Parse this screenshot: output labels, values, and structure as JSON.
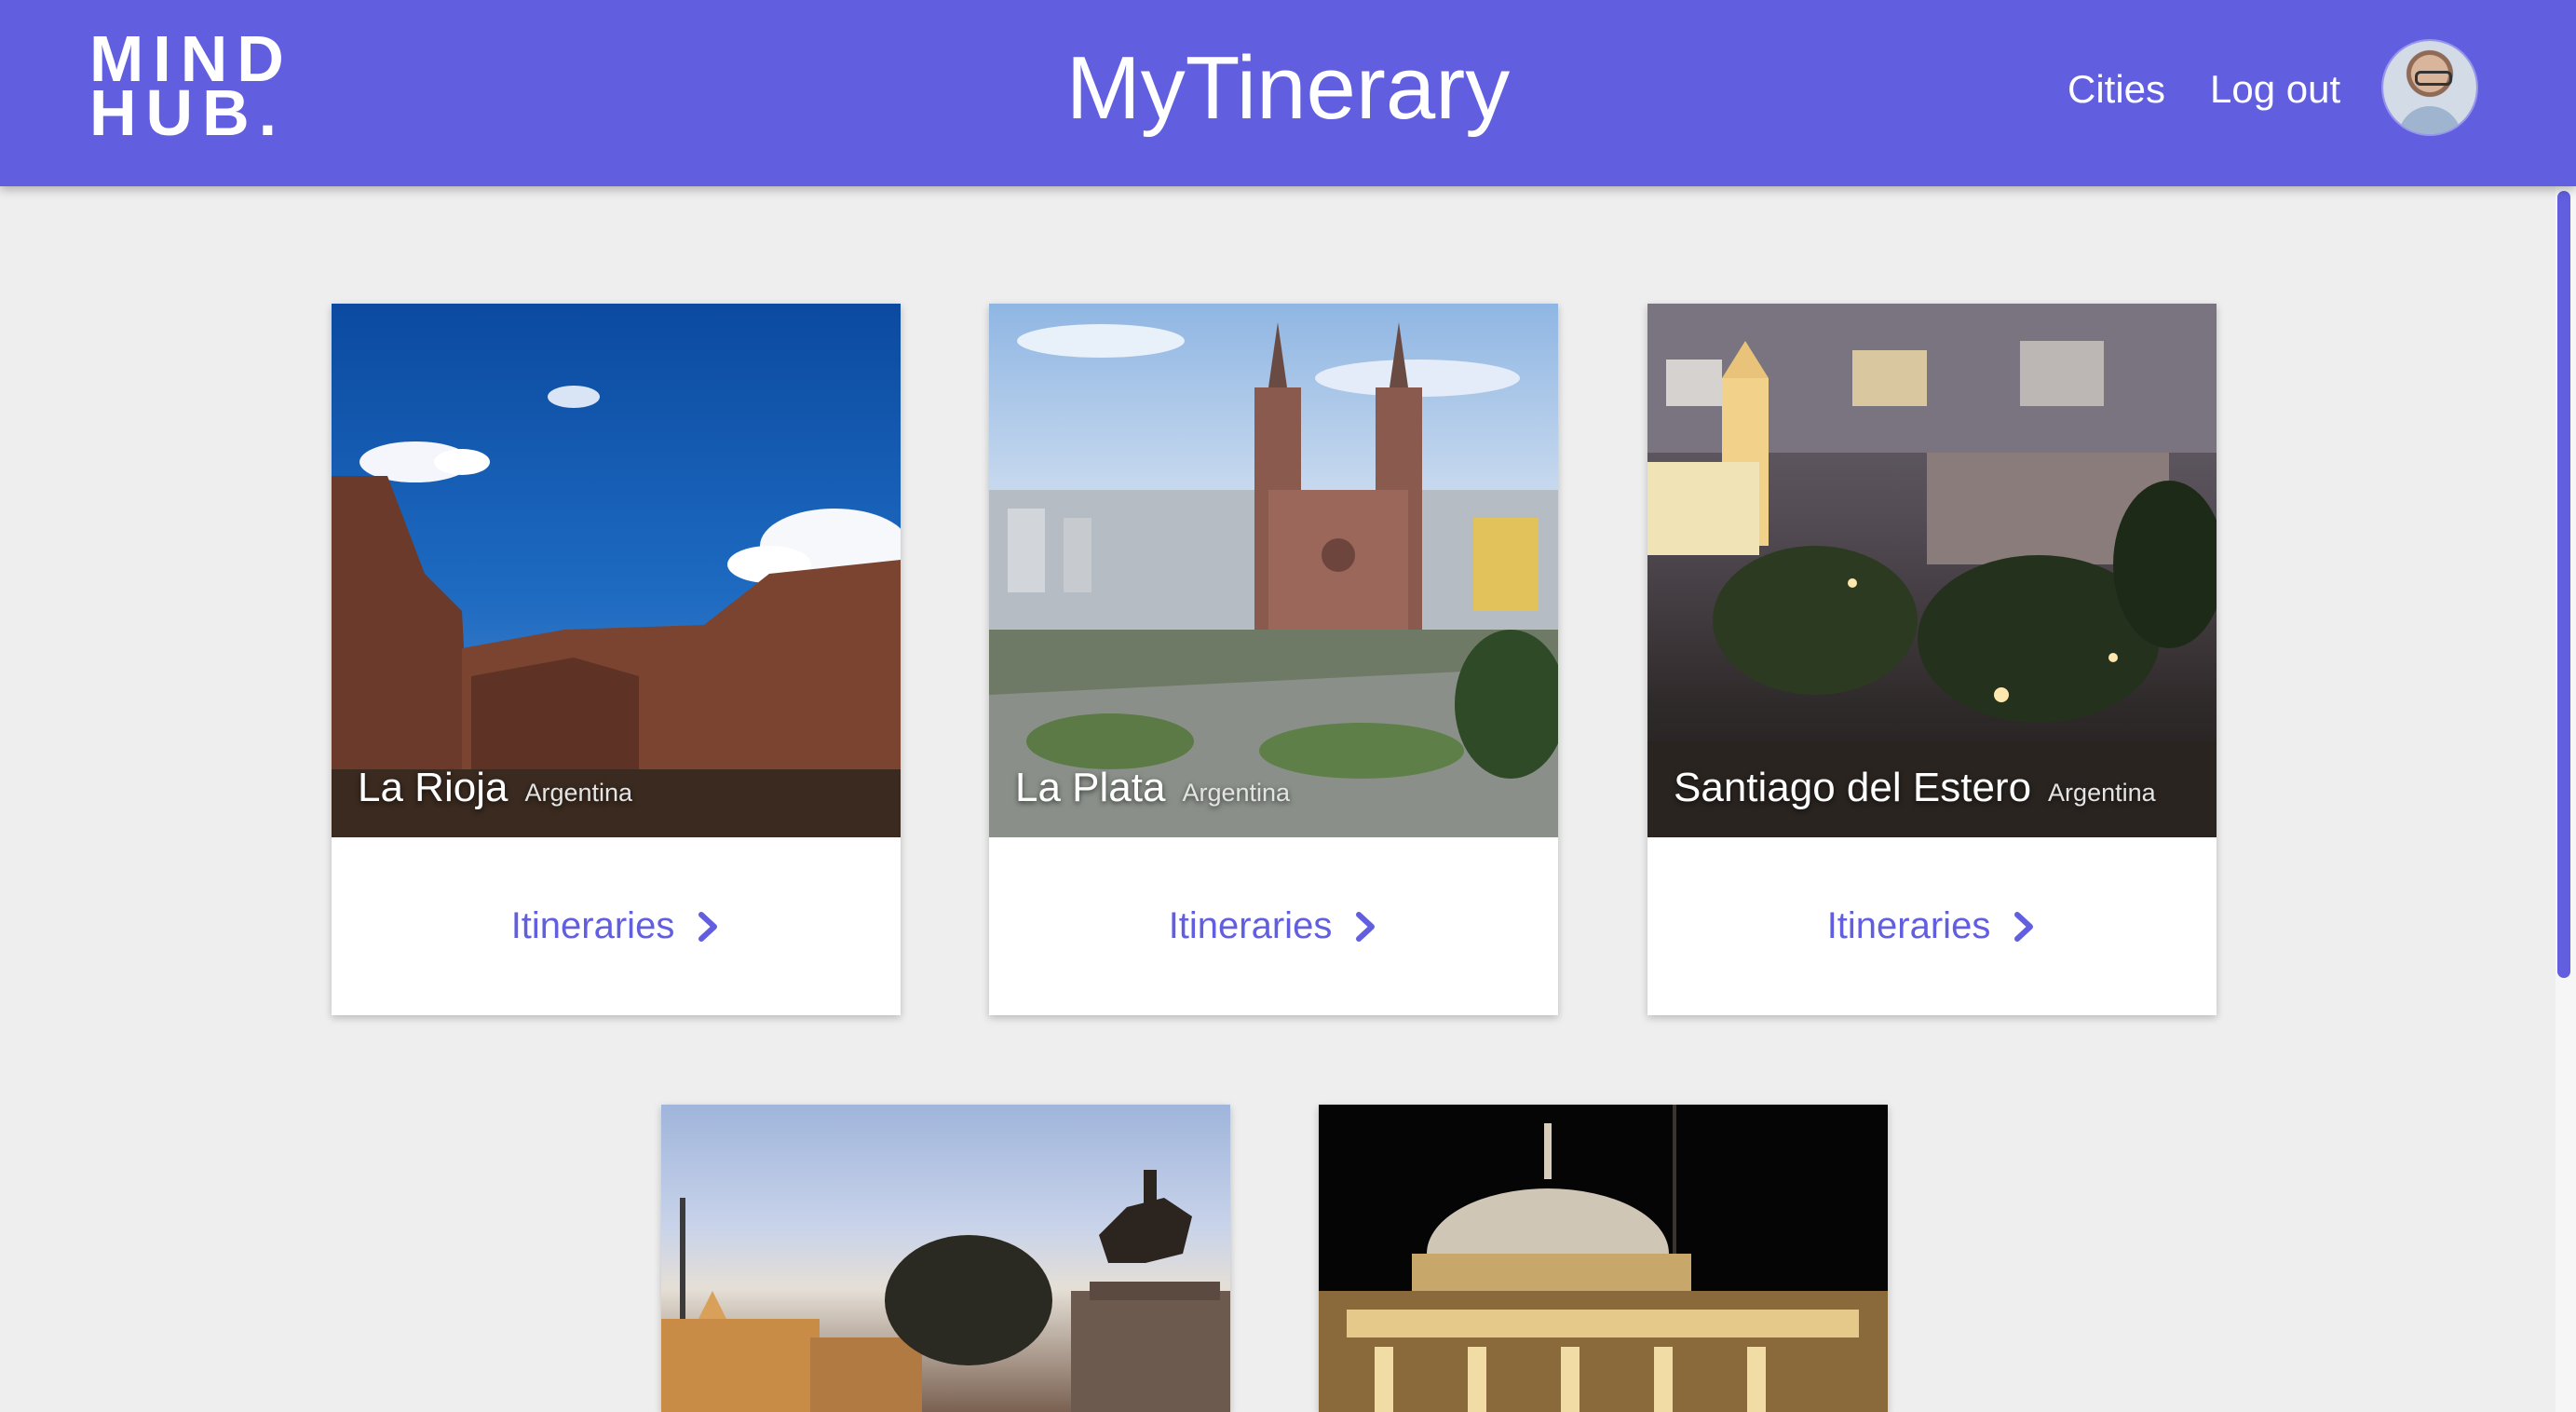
{
  "header": {
    "logo_line1": "MIND",
    "logo_line2": "HUB.",
    "title": "MyTinerary",
    "nav": {
      "cities": "Cities",
      "logout": "Log out"
    }
  },
  "cities": [
    {
      "name": "La Rioja",
      "country": "Argentina",
      "link": "Itineraries"
    },
    {
      "name": "La Plata",
      "country": "Argentina",
      "link": "Itineraries"
    },
    {
      "name": "Santiago del Estero",
      "country": "Argentina",
      "link": "Itineraries"
    },
    {
      "name": "",
      "country": "",
      "link": ""
    },
    {
      "name": "",
      "country": "",
      "link": ""
    }
  ],
  "colors": {
    "brand": "#615fe0",
    "background": "#eeeeee",
    "card": "#ffffff"
  },
  "icons": [
    "chevron-right-icon",
    "avatar"
  ]
}
